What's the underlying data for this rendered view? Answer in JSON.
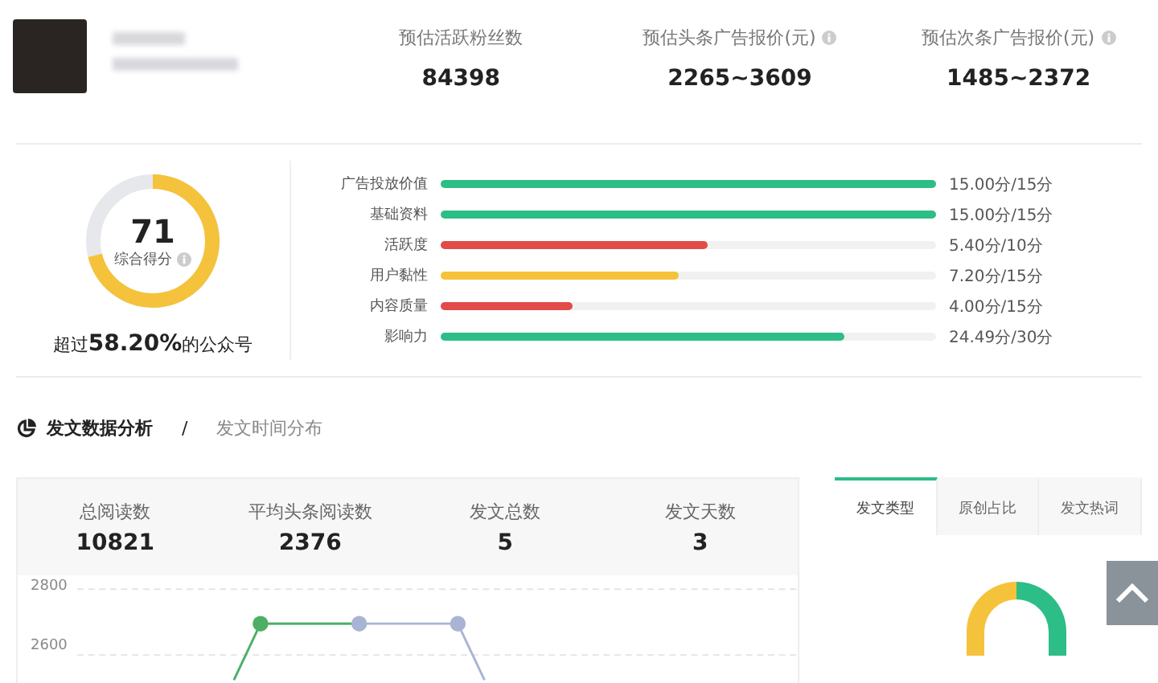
{
  "header": {
    "stats": [
      {
        "label": "预估活跃粉丝数",
        "value": "84398",
        "info": false
      },
      {
        "label": "预估头条广告报价(元)",
        "value": "2265~3609",
        "info": true
      },
      {
        "label": "预估次条广告报价(元)",
        "value": "1485~2372",
        "info": true
      }
    ]
  },
  "score": {
    "value": "71",
    "label": "综合得分",
    "level": 0.71,
    "summary": "超过**58.20%**的公众号",
    "items": [
      {
        "label": "广告投放价值",
        "level": 1,
        "reading": "15.00分/15分",
        "color": "#2dbd87"
      },
      {
        "label": "基础资料",
        "level": 1,
        "reading": "15.00分/15分",
        "color": "#2dbd87"
      },
      {
        "label": "活跃度",
        "level": 0.54,
        "reading": "5.40分/10分",
        "color": "#e24b47"
      },
      {
        "label": "用户黏性",
        "level": 0.48,
        "reading": "7.20分/15分",
        "color": "#f5c23b"
      },
      {
        "label": "内容质量",
        "level": 0.267,
        "reading": "4.00分/15分",
        "color": "#e24b47"
      },
      {
        "label": "影响力",
        "level": 0.816,
        "reading": "24.49分/30分",
        "color": "#2dbd87"
      }
    ]
  },
  "section_tabs": [
    {
      "label": "发文数据分析",
      "selected": true
    },
    {
      "label": "发文时间分布",
      "selected": false
    }
  ],
  "section_separator": "/",
  "summary_stats": [
    {
      "label": "总阅读数",
      "value": "10821"
    },
    {
      "label": "平均头条阅读数",
      "value": "2376"
    },
    {
      "label": "发文总数",
      "value": "5"
    },
    {
      "label": "发文天数",
      "value": "3"
    }
  ],
  "chart": {
    "y_labels": [
      "2800",
      "2600"
    ]
  },
  "type_tabs": [
    {
      "label": "发文类型",
      "selected": true
    },
    {
      "label": "原创占比",
      "selected": false
    },
    {
      "label": "发文热词",
      "selected": false
    }
  ]
}
